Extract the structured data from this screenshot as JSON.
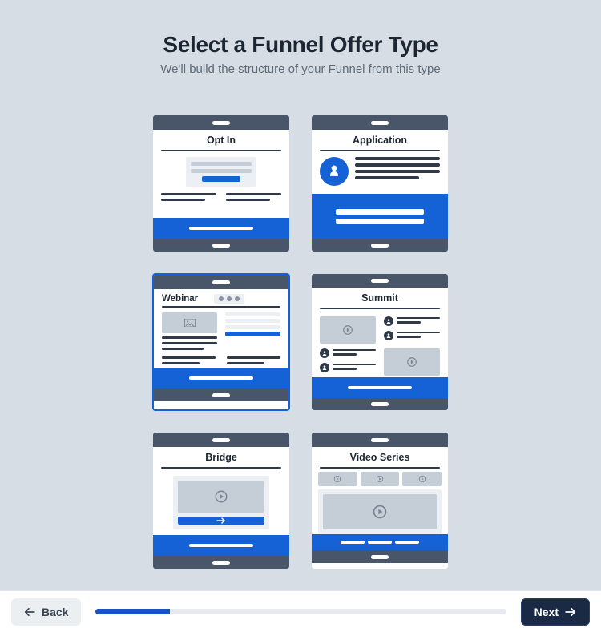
{
  "header": {
    "title": "Select a Funnel Offer Type",
    "subtitle": "We'll build the structure of your Funnel from this type"
  },
  "cards": {
    "optin": {
      "label": "Opt In",
      "selected": false
    },
    "application": {
      "label": "Application",
      "selected": false
    },
    "webinar": {
      "label": "Webinar",
      "selected": true
    },
    "summit": {
      "label": "Summit",
      "selected": false
    },
    "bridge": {
      "label": "Bridge",
      "selected": false
    },
    "video_series": {
      "label": "Video Series",
      "selected": false
    }
  },
  "footer": {
    "back_label": "Back",
    "next_label": "Next",
    "progress_percent": 18
  },
  "colors": {
    "accent": "#1561d6",
    "dark": "#49566a",
    "page_bg": "#d6dde4"
  }
}
